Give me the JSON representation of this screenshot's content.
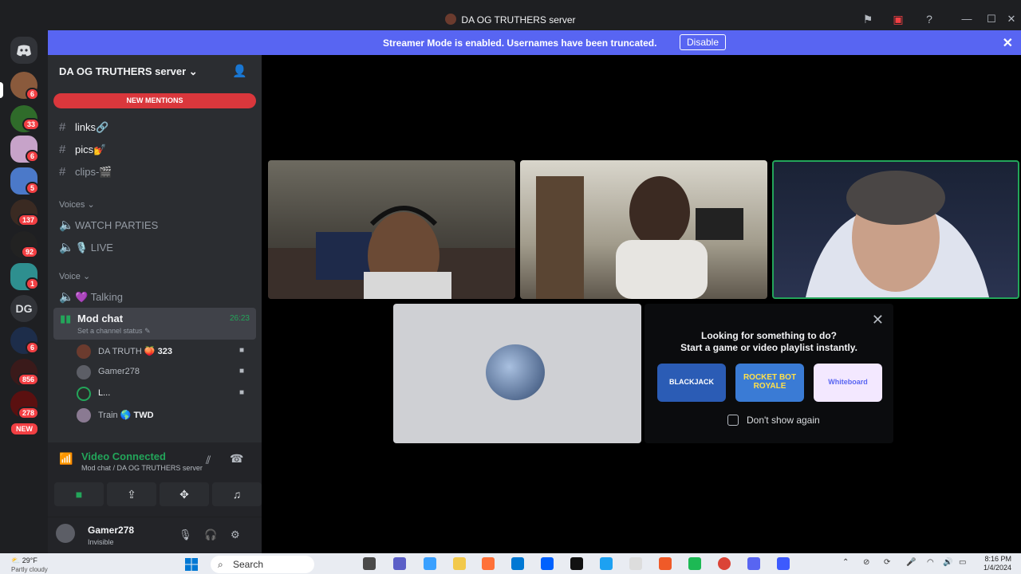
{
  "window": {
    "title": "DA OG TRUTHERS server"
  },
  "banner": {
    "message": "Streamer Mode is enabled. Usernames have been truncated.",
    "disable_label": "Disable"
  },
  "rail": {
    "dm_label": "Direct Messages",
    "guild_label": "DG",
    "badges": [
      "6",
      "33",
      "6",
      "5",
      "137",
      "92",
      "1",
      "6",
      "856",
      "278"
    ],
    "new_label": "NEW"
  },
  "server": {
    "name": "DA OG TRUTHERS server",
    "new_mentions": "NEW MENTIONS",
    "channels": [
      {
        "name": "links🔗"
      },
      {
        "name": "pics💅"
      },
      {
        "name": "clips-🎬"
      }
    ],
    "categories": {
      "voices": "Voices",
      "voice": "Voice"
    },
    "voices_channels": [
      "WATCH PARTIES",
      "🎙️ LIVE"
    ],
    "voice_channels": [
      "💜 Talking"
    ],
    "active_voice": {
      "name": "Mod chat",
      "status_hint": "Set a channel status",
      "elapsed": "26:23"
    },
    "voice_users": [
      {
        "name": "DA TRUTH",
        "extra": "323"
      },
      {
        "name": "Gamer278",
        "extra": ""
      },
      {
        "name": "L...",
        "extra": ""
      },
      {
        "name": "Train",
        "extra": "TWD"
      }
    ]
  },
  "connection": {
    "status": "Video Connected",
    "location": "Mod chat / DA OG TRUTHERS server"
  },
  "user": {
    "name": "Gamer278",
    "status": "Invisible"
  },
  "activity": {
    "title": "Looking for something to do?",
    "subtitle": "Start a game or video playlist instantly.",
    "apps": [
      "BLACKJACK",
      "ROCKET BOT ROYALE",
      "Whiteboard"
    ],
    "dont_show": "Don't show again"
  },
  "taskbar": {
    "weather": "29°F",
    "weather_sub": "Partly cloudy",
    "search": "Search",
    "time": "8:16 PM",
    "date": "1/4/2024"
  }
}
